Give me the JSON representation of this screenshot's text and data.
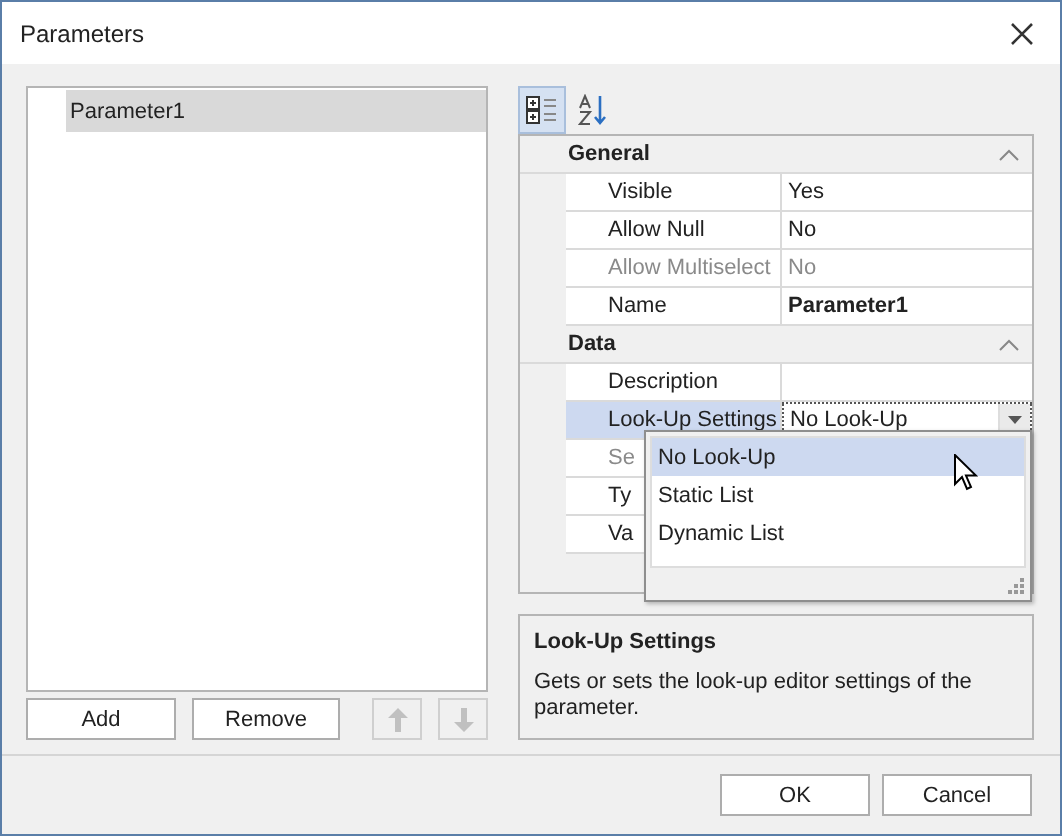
{
  "window": {
    "title": "Parameters"
  },
  "parameters": [
    {
      "label": "Parameter1",
      "selected": true
    }
  ],
  "list_buttons": [
    "Add",
    "Remove"
  ],
  "move_buttons": [
    {
      "kind": "up",
      "disabled": true
    },
    {
      "kind": "down",
      "disabled": true
    }
  ],
  "view_modes": [
    {
      "kind": "categorized",
      "selected": true
    },
    {
      "kind": "alphabetical",
      "selected": false
    }
  ],
  "categories": [
    {
      "title": "General",
      "expanded": true,
      "rows": [
        {
          "name": "Visible",
          "value": "Yes",
          "kind": "text",
          "disabled": false,
          "bold": false,
          "selected": false
        },
        {
          "name": "Allow Null",
          "value": "No",
          "kind": "text",
          "disabled": false,
          "bold": false,
          "selected": false
        },
        {
          "name": "Allow Multiselect",
          "value": "No",
          "kind": "text",
          "disabled": true,
          "bold": false,
          "selected": false
        },
        {
          "name": "Name",
          "value": "Parameter1",
          "kind": "text",
          "disabled": false,
          "bold": true,
          "selected": false
        }
      ]
    },
    {
      "title": "Data",
      "expanded": true,
      "rows": [
        {
          "name": "Description",
          "kind": "empty",
          "disabled": false,
          "selected": false
        },
        {
          "name": "Look-Up Settings",
          "value": "No Look-Up",
          "kind": "dropdown",
          "disabled": false,
          "selected": true
        },
        {
          "name": "Se",
          "kind": "empty",
          "disabled": true,
          "selected": false
        },
        {
          "name": "Ty",
          "kind": "empty",
          "disabled": false,
          "selected": false
        },
        {
          "name": "Va",
          "kind": "empty",
          "disabled": false,
          "selected": false
        }
      ]
    }
  ],
  "dropdown_options": [
    {
      "label": "No Look-Up",
      "selected": true
    },
    {
      "label": "Static List",
      "selected": false
    },
    {
      "label": "Dynamic List",
      "selected": false
    }
  ],
  "description": {
    "title": "Look-Up Settings",
    "text": "Gets or sets the look-up editor settings of the parameter."
  },
  "dialog_buttons": [
    "OK",
    "Cancel"
  ]
}
